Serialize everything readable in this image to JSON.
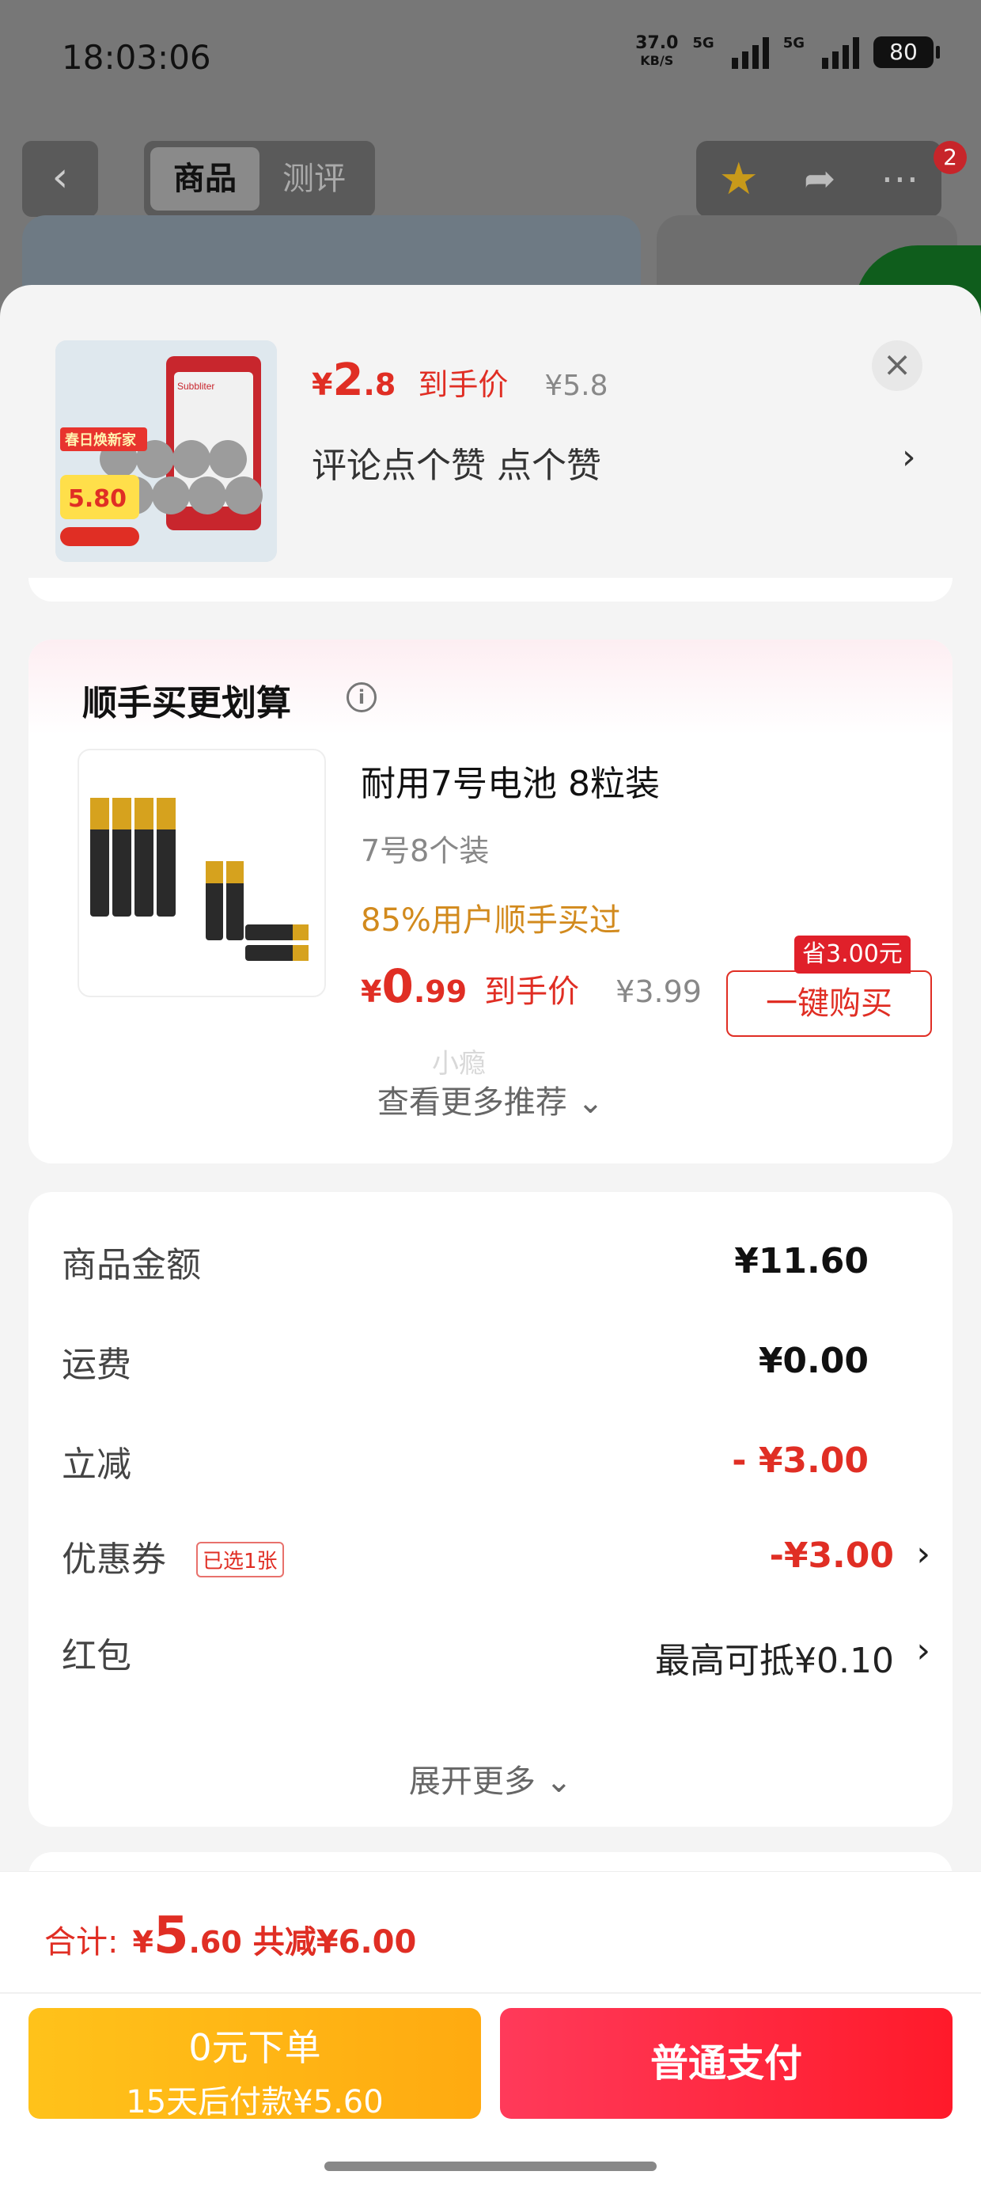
{
  "status_bar": {
    "time": "18:03:06",
    "net_speed": "37.0",
    "net_unit": "KB/S",
    "sig1_label": "5G",
    "sig2_label": "5G",
    "battery": "80"
  },
  "nav": {
    "back_icon": "chevron-left-icon",
    "tabs": [
      {
        "label": "商品",
        "active": true
      },
      {
        "label": "测评",
        "active": false
      }
    ],
    "more_badge": "2"
  },
  "product": {
    "currency": "¥",
    "price_int": "2",
    "price_dec": ".8",
    "price_label": "到手价",
    "original_price": "¥5.8",
    "review_text": "评论点个赞  点个赞",
    "thumb_badge": "5.80",
    "thumb_banner": "春日焕新家",
    "thumb_brand": "Subbliter"
  },
  "bundle": {
    "title": "顺手买更划算",
    "name": "耐用7号电池 8粒装",
    "spec": "7号8个装",
    "stat": "85%用户顺手买过",
    "currency": "¥",
    "price_int": "0",
    "price_dec": ".99",
    "price_label": "到手价",
    "original_price": "¥3.99",
    "save_tag": "省3.00元",
    "buy_label": "一键购买",
    "watermark": "小瘾",
    "more_label": "查看更多推荐 ⌄"
  },
  "summary": {
    "rows": [
      {
        "label": "商品金额",
        "value": "¥11.60"
      },
      {
        "label": "运费",
        "value": "¥0.00"
      },
      {
        "label": "立减",
        "value": "- ¥3.00"
      },
      {
        "label": "优惠券",
        "value": "-¥3.00",
        "tag": "已选1张"
      },
      {
        "label": "红包",
        "value": "最高可抵¥0.10"
      }
    ],
    "expand_label": "展开更多 ⌄"
  },
  "footer": {
    "total_label": "合计:",
    "currency": "¥",
    "total_int": "5",
    "total_dec": ".60",
    "total_save": "共减¥6.00",
    "zero_btn_line1": "0元下单",
    "zero_btn_line2": "15天后付款¥5.60",
    "pay_btn": "普通支付"
  },
  "colors": {
    "accent_red": "#e02e24",
    "orange": "#d28a1d",
    "yellow_button": "#ffb51a",
    "pay_button": "#ff2a3e"
  }
}
